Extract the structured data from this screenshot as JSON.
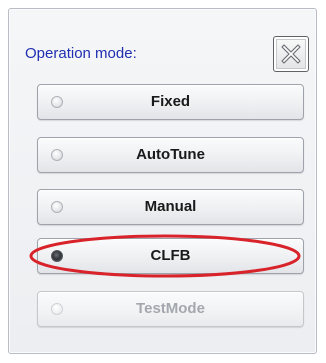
{
  "dialog": {
    "title": "Operation mode:",
    "close_icon": "close-x-icon"
  },
  "modes": [
    {
      "label": "Fixed",
      "selected": false,
      "enabled": true
    },
    {
      "label": "AutoTune",
      "selected": false,
      "enabled": true
    },
    {
      "label": "Manual",
      "selected": false,
      "enabled": true
    },
    {
      "label": "CLFB",
      "selected": true,
      "enabled": true
    },
    {
      "label": "TestMode",
      "selected": false,
      "enabled": false
    }
  ],
  "annotation": {
    "shape": "ellipse",
    "color": "#d8232a",
    "target": "CLFB"
  },
  "colors": {
    "title": "#1f2fb0",
    "disabled_text": "#a4a8ae"
  }
}
